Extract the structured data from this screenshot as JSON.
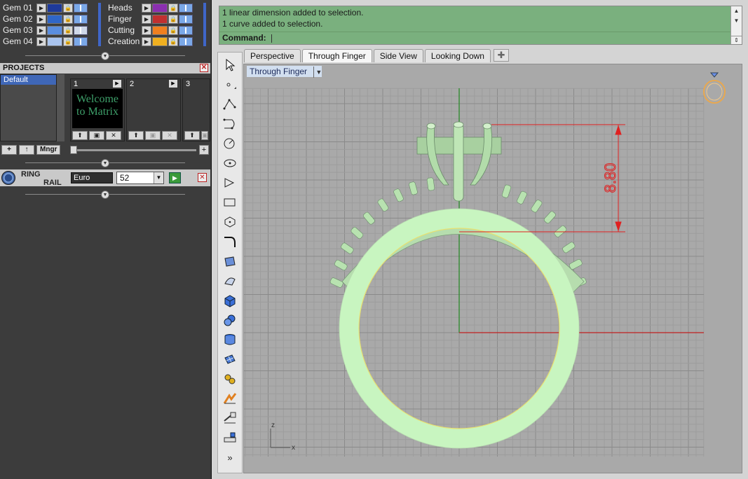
{
  "left_panel": {
    "layers_left": [
      {
        "name": "Gem 01",
        "color": "#1e3a9a"
      },
      {
        "name": "Gem 02",
        "color": "#2f66c8"
      },
      {
        "name": "Gem 03",
        "color": "#5a8ee0"
      },
      {
        "name": "Gem 04",
        "color": "#a9c4ee"
      }
    ],
    "layers_right": [
      {
        "name": "Heads",
        "color": "#8a2fb0"
      },
      {
        "name": "Finger",
        "color": "#c03030"
      },
      {
        "name": "Cutting",
        "color": "#f08020"
      },
      {
        "name": "Creation",
        "color": "#f0b020"
      }
    ],
    "projects": {
      "header": "PROJECTS",
      "list_items": [
        "Default"
      ],
      "slots": [
        {
          "number": "1",
          "thumb_text": "Welcome to Matrix"
        },
        {
          "number": "2",
          "thumb_text": ""
        },
        {
          "number": "3",
          "thumb_text": ""
        }
      ],
      "tools": [
        "+",
        "↑",
        "Mngr"
      ]
    },
    "ring_rail": {
      "label_line1": "RING",
      "label_line2": "RAIL",
      "standard": "Euro",
      "size": "52"
    }
  },
  "command": {
    "history": [
      "1 linear dimension added to selection.",
      "1 curve added to selection."
    ],
    "prompt": "Command:"
  },
  "tabs": [
    "Perspective",
    "Through Finger",
    "Side View",
    "Looking Down"
  ],
  "active_tab": "Through Finger",
  "viewport": {
    "title": "Through Finger",
    "dimension": "8.80",
    "axis_x": "x",
    "axis_z": "z",
    "colors": {
      "ring": "#c8f5c0",
      "dimension": "#e02020",
      "grid_bg": "#a9a9a9"
    }
  },
  "toolbar_more": "»"
}
